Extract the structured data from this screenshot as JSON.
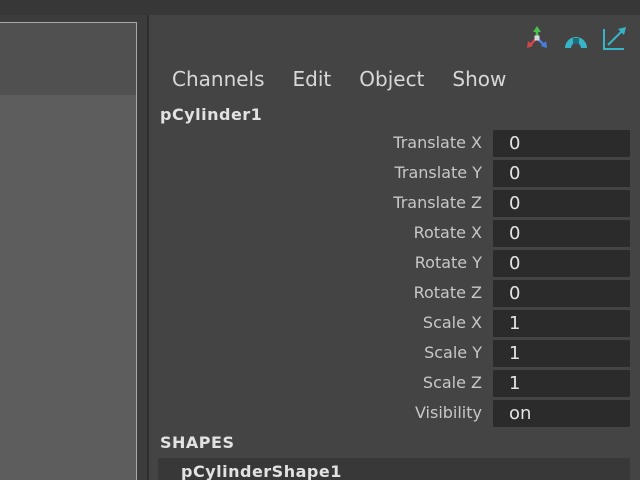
{
  "menu": {
    "items": [
      {
        "label": "Channels"
      },
      {
        "label": "Edit"
      },
      {
        "label": "Object"
      },
      {
        "label": "Show"
      }
    ]
  },
  "toolbar": {
    "icons": [
      "manipulator-icon",
      "channel-box-layer-icon",
      "attribute-editor-toggle-icon"
    ]
  },
  "node": {
    "name": "pCylinder1"
  },
  "attributes": [
    {
      "label": "Translate X",
      "value": "0"
    },
    {
      "label": "Translate Y",
      "value": "0"
    },
    {
      "label": "Translate Z",
      "value": "0"
    },
    {
      "label": "Rotate X",
      "value": "0"
    },
    {
      "label": "Rotate Y",
      "value": "0"
    },
    {
      "label": "Rotate Z",
      "value": "0"
    },
    {
      "label": "Scale X",
      "value": "1"
    },
    {
      "label": "Scale Y",
      "value": "1"
    },
    {
      "label": "Scale Z",
      "value": "1"
    },
    {
      "label": "Visibility",
      "value": "on"
    }
  ],
  "shapes": {
    "header": "SHAPES",
    "items": [
      {
        "name": "pCylinderShape1"
      }
    ]
  },
  "colors": {
    "panel_bg": "#444444",
    "field_bg": "#2b2b2b",
    "text": "#d8d8d8",
    "accent_teal": "#37b5c7"
  }
}
